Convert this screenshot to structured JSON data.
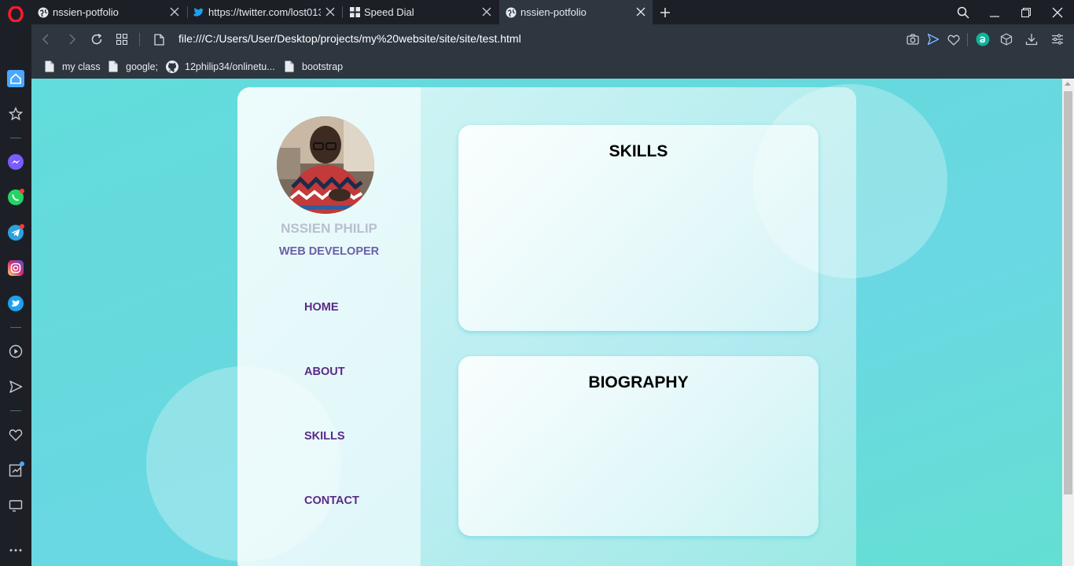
{
  "browser": {
    "tabs": [
      {
        "title": "nssien-potfolio",
        "icon": "globe-icon"
      },
      {
        "title": "https://twitter.com/lost013",
        "icon": "twitter-icon"
      },
      {
        "title": "Speed Dial",
        "icon": "speed-dial-icon"
      },
      {
        "title": "nssien-potfolio",
        "icon": "globe-icon"
      }
    ],
    "url": "file:///C:/Users/User/Desktop/projects/my%20website/site/site/test.html",
    "bookmarks": [
      {
        "label": "my class",
        "icon": "page-icon"
      },
      {
        "label": "google;",
        "icon": "page-icon"
      },
      {
        "label": "12philip34/onlinetu...",
        "icon": "github-icon"
      },
      {
        "label": "bootstrap",
        "icon": "page-icon"
      }
    ],
    "colors": {
      "accent": "#4a9eff",
      "opera_red": "#ff1b2d",
      "frame": "#1c2026",
      "toolbar": "#2e3640"
    }
  },
  "page": {
    "profile": {
      "name": "NSSIEN PHILIP",
      "role": "WEB DEVELOPER"
    },
    "nav": [
      "HOME",
      "ABOUT",
      "SKILLS",
      "CONTACT"
    ],
    "sections": {
      "skills_title": "SKILLS",
      "biography_title": "BIOGRAPHY"
    },
    "colors": {
      "background": "#66dadd",
      "nav_text": "#5a2a86",
      "role_text": "#6b60a8",
      "name_text": "#b9bfcf"
    }
  }
}
